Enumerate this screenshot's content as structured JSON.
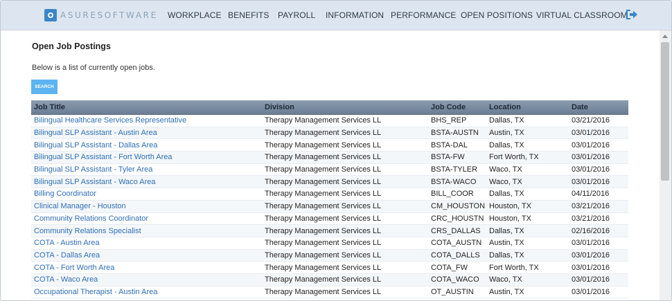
{
  "brand": {
    "logo_text": "ASURESOFTWARE"
  },
  "nav": {
    "items": [
      {
        "label": "WORKPLACE"
      },
      {
        "label": "BENEFITS"
      },
      {
        "label": "PAYROLL"
      },
      {
        "label": "INFORMATION"
      },
      {
        "label": "PERFORMANCE"
      },
      {
        "label": "OPEN POSITIONS"
      },
      {
        "label": "VIRTUAL CLASSROOM"
      }
    ],
    "logout_icon": "logout-icon"
  },
  "page": {
    "title": "Open Job Postings",
    "intro": "Below is a list of currently open jobs.",
    "search_label": "SEARCH"
  },
  "table": {
    "columns": [
      "Job Title",
      "Division",
      "Job Code",
      "Location",
      "Date"
    ],
    "rows": [
      [
        "Bilingual Healthcare Services Representative",
        "Therapy Management Services LL",
        "BHS_REP",
        "Dallas, TX",
        "03/21/2016"
      ],
      [
        "Bilingual SLP Assistant - Austin Area",
        "Therapy Management Services LL",
        "BSTA-AUSTN",
        "Austin, TX",
        "03/01/2016"
      ],
      [
        "Bilingual SLP Assistant - Dallas Area",
        "Therapy Management Services LL",
        "BSTA-DAL",
        "Dallas, TX",
        "03/01/2016"
      ],
      [
        "Bilingual SLP Assistant - Fort Worth Area",
        "Therapy Management Services LL",
        "BSTA-FW",
        "Fort Worth, TX",
        "03/01/2016"
      ],
      [
        "Bilingual SLP Assistant - Tyler Area",
        "Therapy Management Services LL",
        "BSTA-TYLER",
        "Waco, TX",
        "03/01/2016"
      ],
      [
        "Bilingual SLP Assistant - Waco Area",
        "Therapy Management Services LL",
        "BSTA-WACO",
        "Waco, TX",
        "03/01/2016"
      ],
      [
        "Billing Coordinator",
        "Therapy Management Services LL",
        "BILL_COOR",
        "Dallas, TX",
        "04/11/2016"
      ],
      [
        "Clinical Manager - Houston",
        "Therapy Management Services LL",
        "CM_HOUSTON",
        "Houston, TX",
        "03/21/2016"
      ],
      [
        "Community Relations Coordinator",
        "Therapy Management Services LL",
        "CRC_HOUSTN",
        "Houston, TX",
        "03/21/2016"
      ],
      [
        "Community Relations Specialist",
        "Therapy Management Services LL",
        "CRS_DALLAS",
        "Dallas, TX",
        "02/16/2016"
      ],
      [
        "COTA - Austin Area",
        "Therapy Management Services LL",
        "COTA_AUSTN",
        "Austin, TX",
        "03/01/2016"
      ],
      [
        "COTA - Dallas Area",
        "Therapy Management Services LL",
        "COTA_DALLS",
        "Dallas, TX",
        "03/01/2016"
      ],
      [
        "COTA - Fort Worth Area",
        "Therapy Management Services LL",
        "COTA_FW",
        "Fort Worth, TX",
        "03/01/2016"
      ],
      [
        "COTA - Waco Area",
        "Therapy Management Services LL",
        "COTA_WACO",
        "Waco, TX",
        "03/01/2016"
      ],
      [
        "Occupational Therapist - Austin Area",
        "Therapy Management Services LL",
        "OT_AUSTIN",
        "Austin, TX",
        "03/01/2016"
      ]
    ]
  },
  "colors": {
    "accent": "#5cb4f0",
    "link": "#2f6fb4",
    "header_bar": "#dde6f0",
    "logo": "#3a86c8"
  }
}
